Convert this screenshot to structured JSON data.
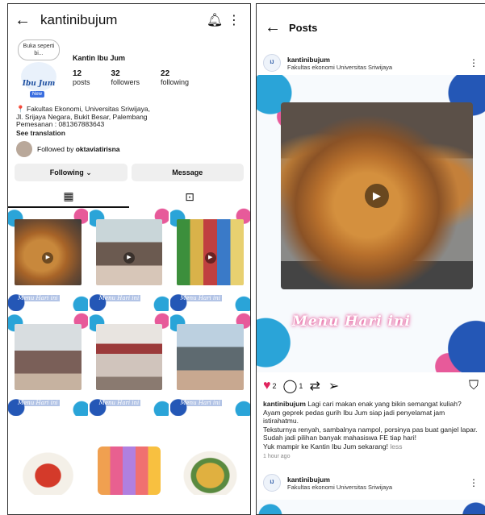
{
  "profile": {
    "username": "kantinibujum",
    "back_icon": "arrow-left-icon",
    "bell_icon": "bell-icon",
    "more_icon": "more-vertical-icon",
    "avatar_bubble": "Buka seperti bi...",
    "avatar_logo": "Ibu Jum",
    "avatar_badge": "New",
    "display_name": "Kantin Ibu Jum",
    "stats": [
      {
        "num": "12",
        "label": "posts"
      },
      {
        "num": "32",
        "label": "followers"
      },
      {
        "num": "22",
        "label": "following"
      }
    ],
    "bio_lines": [
      "📍 Fakultas Ekonomi, Universitas Sriwijaya,",
      "Jl. Srijaya Negara, Bukit Besar, Palembang",
      "Pemesanan : 081367883643"
    ],
    "see_translation": "See translation",
    "followed_by_prefix": "Followed by ",
    "followed_by_user": "oktaviatirisna",
    "following_btn": "Following ⌄",
    "message_btn": "Message",
    "tab_grid_icon": "grid-icon",
    "tab_tagged_icon": "tagged-person-icon",
    "grid_caption": "Menu Hari ini",
    "grid_caption2": "Menu Hari ini"
  },
  "post": {
    "title": "Posts",
    "account": "kantinibujum",
    "location": "Fakultas ekonomi Universitas Sriwijaya",
    "media_caption": "Menu Hari ini",
    "likes": "2",
    "comments": "1",
    "caption_user": "kantinibujum",
    "caption_lines": [
      " Lagi cari makan enak yang bikin semangat kuliah?",
      "Ayam geprek pedas gurih Ibu Jum siap jadi penyelamat jam",
      "istirahatmu.",
      "Teksturnya renyah, sambalnya nampol, porsinya pas buat ganjel lapar.",
      "Sudah jadi pilihan banyak mahasiswa FE tiap hari!",
      "Yuk mampir ke Kantin Ibu Jum sekarang!"
    ],
    "less": "less",
    "time_ago": "1 hour ago",
    "next_account": "kantinibujum",
    "next_location": "Fakultas ekonomi Universitas Sriwijaya"
  }
}
